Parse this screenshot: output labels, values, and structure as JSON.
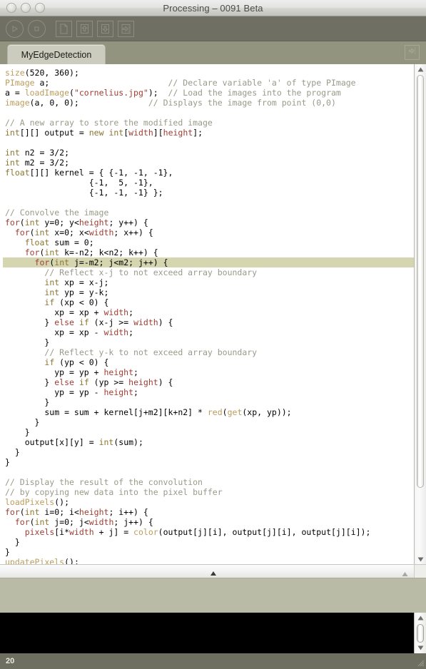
{
  "window": {
    "title": "Processing – 0091 Beta",
    "traffic_lights": [
      "close",
      "minimize",
      "zoom"
    ]
  },
  "toolbar": {
    "buttons": [
      {
        "name": "run-button",
        "icon": "play-icon",
        "label": "Run"
      },
      {
        "name": "stop-button",
        "icon": "stop-icon",
        "label": "Stop"
      },
      {
        "name": "new-button",
        "icon": "new-file-icon",
        "label": "New"
      },
      {
        "name": "open-button",
        "icon": "open-up-arrow-icon",
        "label": "Open"
      },
      {
        "name": "save-button",
        "icon": "save-down-arrow-icon",
        "label": "Save"
      },
      {
        "name": "export-button",
        "icon": "export-right-arrow-icon",
        "label": "Export"
      }
    ]
  },
  "tabs": {
    "items": [
      {
        "label": "MyEdgeDetection",
        "active": true
      }
    ],
    "right_button_icon": "export-arrow-icon"
  },
  "editor": {
    "current_line_index": 20,
    "lines": [
      [
        {
          "t": "size",
          "c": "fn"
        },
        {
          "t": "(520, 360);",
          "c": ""
        }
      ],
      [
        {
          "t": "PImage",
          "c": "fn"
        },
        {
          "t": " a;",
          "c": ""
        },
        {
          "t": "                        ",
          "c": ""
        },
        {
          "t": "// Declare variable 'a' of type PImage",
          "c": "cm"
        }
      ],
      [
        {
          "t": "a = ",
          "c": ""
        },
        {
          "t": "loadImage",
          "c": "fn"
        },
        {
          "t": "(",
          "c": ""
        },
        {
          "t": "\"cornelius.jpg\"",
          "c": "str"
        },
        {
          "t": ");  ",
          "c": ""
        },
        {
          "t": "// Load the images into the program",
          "c": "cm"
        }
      ],
      [
        {
          "t": "image",
          "c": "fn"
        },
        {
          "t": "(a, 0, 0);",
          "c": ""
        },
        {
          "t": "              ",
          "c": ""
        },
        {
          "t": "// Displays the image from point (0,0)",
          "c": "cm"
        }
      ],
      [
        {
          "t": "",
          "c": ""
        }
      ],
      [
        {
          "t": "// A new array to store the modified image",
          "c": "cm"
        }
      ],
      [
        {
          "t": "int",
          "c": "kw"
        },
        {
          "t": "[][] output = ",
          "c": ""
        },
        {
          "t": "new",
          "c": "kw"
        },
        {
          "t": " ",
          "c": ""
        },
        {
          "t": "int",
          "c": "kw"
        },
        {
          "t": "[",
          "c": ""
        },
        {
          "t": "width",
          "c": "kw2"
        },
        {
          "t": "][",
          "c": ""
        },
        {
          "t": "height",
          "c": "kw2"
        },
        {
          "t": "];",
          "c": ""
        }
      ],
      [
        {
          "t": "",
          "c": ""
        }
      ],
      [
        {
          "t": "int",
          "c": "kw"
        },
        {
          "t": " n2 = 3/2;",
          "c": ""
        }
      ],
      [
        {
          "t": "int",
          "c": "kw"
        },
        {
          "t": " m2 = 3/2;",
          "c": ""
        }
      ],
      [
        {
          "t": "float",
          "c": "kw"
        },
        {
          "t": "[][] kernel = { {-1, -1, -1},",
          "c": ""
        }
      ],
      [
        {
          "t": "                 {-1,  5, -1},",
          "c": ""
        }
      ],
      [
        {
          "t": "                 {-1, -1, -1} };",
          "c": ""
        }
      ],
      [
        {
          "t": "",
          "c": ""
        }
      ],
      [
        {
          "t": "// Convolve the image",
          "c": "cm"
        }
      ],
      [
        {
          "t": "for",
          "c": "kw2"
        },
        {
          "t": "(",
          "c": ""
        },
        {
          "t": "int",
          "c": "kw"
        },
        {
          "t": " y=0; y<",
          "c": ""
        },
        {
          "t": "height",
          "c": "kw2"
        },
        {
          "t": "; y++) {",
          "c": ""
        }
      ],
      [
        {
          "t": "  ",
          "c": ""
        },
        {
          "t": "for",
          "c": "kw2"
        },
        {
          "t": "(",
          "c": ""
        },
        {
          "t": "int",
          "c": "kw"
        },
        {
          "t": " x=0; x<",
          "c": ""
        },
        {
          "t": "width",
          "c": "kw2"
        },
        {
          "t": "; x++) {",
          "c": ""
        }
      ],
      [
        {
          "t": "    ",
          "c": ""
        },
        {
          "t": "float",
          "c": "kw"
        },
        {
          "t": " sum = 0;",
          "c": ""
        }
      ],
      [
        {
          "t": "    ",
          "c": ""
        },
        {
          "t": "for",
          "c": "kw2"
        },
        {
          "t": "(",
          "c": ""
        },
        {
          "t": "int",
          "c": "kw"
        },
        {
          "t": " k=-n2; k<n2; k++) {",
          "c": ""
        }
      ],
      [
        {
          "t": "      ",
          "c": ""
        },
        {
          "t": "for",
          "c": "kw2"
        },
        {
          "t": "(",
          "c": ""
        },
        {
          "t": "int",
          "c": "kw"
        },
        {
          "t": " j=-m2; j<m2; j++) {",
          "c": ""
        }
      ],
      [
        {
          "t": "        ",
          "c": ""
        },
        {
          "t": "// Reflect x-j to not exceed array boundary",
          "c": "cm"
        }
      ],
      [
        {
          "t": "        ",
          "c": ""
        },
        {
          "t": "int",
          "c": "kw"
        },
        {
          "t": " xp = x-j;",
          "c": ""
        }
      ],
      [
        {
          "t": "        ",
          "c": ""
        },
        {
          "t": "int",
          "c": "kw"
        },
        {
          "t": " yp = y-k;",
          "c": ""
        }
      ],
      [
        {
          "t": "        ",
          "c": ""
        },
        {
          "t": "if",
          "c": "kw"
        },
        {
          "t": " (xp < 0) {",
          "c": ""
        }
      ],
      [
        {
          "t": "          xp = xp + ",
          "c": ""
        },
        {
          "t": "width",
          "c": "kw2"
        },
        {
          "t": ";",
          "c": ""
        }
      ],
      [
        {
          "t": "        } ",
          "c": ""
        },
        {
          "t": "else",
          "c": "kw2"
        },
        {
          "t": " ",
          "c": ""
        },
        {
          "t": "if",
          "c": "kw"
        },
        {
          "t": " (x-j >= ",
          "c": ""
        },
        {
          "t": "width",
          "c": "kw2"
        },
        {
          "t": ") {",
          "c": ""
        }
      ],
      [
        {
          "t": "          xp = xp - ",
          "c": ""
        },
        {
          "t": "width",
          "c": "kw2"
        },
        {
          "t": ";",
          "c": ""
        }
      ],
      [
        {
          "t": "        }",
          "c": ""
        }
      ],
      [
        {
          "t": "        ",
          "c": ""
        },
        {
          "t": "// Reflect y-k to not exceed array boundary",
          "c": "cm"
        }
      ],
      [
        {
          "t": "        ",
          "c": ""
        },
        {
          "t": "if",
          "c": "kw"
        },
        {
          "t": " (yp < 0) {",
          "c": ""
        }
      ],
      [
        {
          "t": "          yp = yp + ",
          "c": ""
        },
        {
          "t": "height",
          "c": "kw2"
        },
        {
          "t": ";",
          "c": ""
        }
      ],
      [
        {
          "t": "        } ",
          "c": ""
        },
        {
          "t": "else",
          "c": "kw2"
        },
        {
          "t": " ",
          "c": ""
        },
        {
          "t": "if",
          "c": "kw"
        },
        {
          "t": " (yp >= ",
          "c": ""
        },
        {
          "t": "height",
          "c": "kw2"
        },
        {
          "t": ") {",
          "c": ""
        }
      ],
      [
        {
          "t": "          yp = yp - ",
          "c": ""
        },
        {
          "t": "height",
          "c": "kw2"
        },
        {
          "t": ";",
          "c": ""
        }
      ],
      [
        {
          "t": "        }",
          "c": ""
        }
      ],
      [
        {
          "t": "        sum = sum + kernel[j+m2][k+n2] * ",
          "c": ""
        },
        {
          "t": "red",
          "c": "fn"
        },
        {
          "t": "(",
          "c": ""
        },
        {
          "t": "get",
          "c": "fn"
        },
        {
          "t": "(xp, yp));",
          "c": ""
        }
      ],
      [
        {
          "t": "      }",
          "c": ""
        }
      ],
      [
        {
          "t": "    }",
          "c": ""
        }
      ],
      [
        {
          "t": "    output[x][y] = ",
          "c": ""
        },
        {
          "t": "int",
          "c": "kw"
        },
        {
          "t": "(sum);",
          "c": ""
        }
      ],
      [
        {
          "t": "  }",
          "c": ""
        }
      ],
      [
        {
          "t": "}",
          "c": ""
        }
      ],
      [
        {
          "t": "",
          "c": ""
        }
      ],
      [
        {
          "t": "// Display the result of the convolution",
          "c": "cm"
        }
      ],
      [
        {
          "t": "// by copying new data into the pixel buffer",
          "c": "cm"
        }
      ],
      [
        {
          "t": "loadPixels",
          "c": "fn"
        },
        {
          "t": "();",
          "c": ""
        }
      ],
      [
        {
          "t": "for",
          "c": "kw2"
        },
        {
          "t": "(",
          "c": ""
        },
        {
          "t": "int",
          "c": "kw"
        },
        {
          "t": " i=0; i<",
          "c": ""
        },
        {
          "t": "height",
          "c": "kw2"
        },
        {
          "t": "; i++) {",
          "c": ""
        }
      ],
      [
        {
          "t": "  ",
          "c": ""
        },
        {
          "t": "for",
          "c": "kw2"
        },
        {
          "t": "(",
          "c": ""
        },
        {
          "t": "int",
          "c": "kw"
        },
        {
          "t": " j=0; j<",
          "c": ""
        },
        {
          "t": "width",
          "c": "kw2"
        },
        {
          "t": "; j++) {",
          "c": ""
        }
      ],
      [
        {
          "t": "    ",
          "c": ""
        },
        {
          "t": "pixels",
          "c": "kw2"
        },
        {
          "t": "[i*",
          "c": ""
        },
        {
          "t": "width",
          "c": "kw2"
        },
        {
          "t": " + j] = ",
          "c": ""
        },
        {
          "t": "color",
          "c": "fn"
        },
        {
          "t": "(output[j][i], output[j][i], output[j][i]);",
          "c": ""
        }
      ],
      [
        {
          "t": "  }",
          "c": ""
        }
      ],
      [
        {
          "t": "}",
          "c": ""
        }
      ],
      [
        {
          "t": "updatePixels",
          "c": "fn"
        },
        {
          "t": "();",
          "c": ""
        }
      ]
    ]
  },
  "message_bar": {
    "text": ""
  },
  "console": {
    "text": ""
  },
  "status_bar": {
    "line_number": "20"
  },
  "colors": {
    "chrome": "#6e6f60",
    "tabbar": "#93947f",
    "tab_active": "#cbccbd",
    "editor_bg": "#ffffff",
    "current_line": "#d5d5b0",
    "message_bar": "#b9bba6",
    "console_bg": "#000000",
    "comment": "#999a89",
    "function": "#bb9d5e",
    "keyword": "#8c7530",
    "keyword2": "#9e3e34",
    "string": "#9e3e34"
  }
}
